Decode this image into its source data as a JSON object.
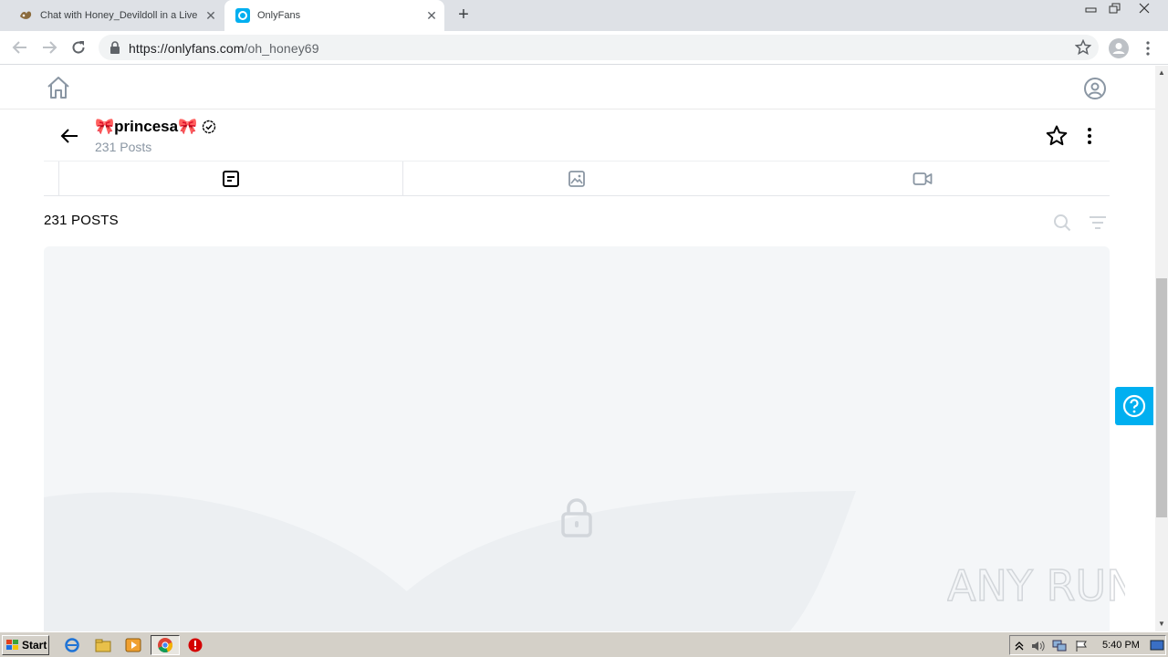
{
  "browser": {
    "tabs": [
      {
        "title": "Chat with Honey_Devildoll in a Live A",
        "active": false
      },
      {
        "title": "OnlyFans",
        "active": true
      }
    ],
    "url_host": "https://onlyfans.com",
    "url_path": "/oh_honey69"
  },
  "profile": {
    "name": "🎀princesa🎀",
    "posts_subtitle": "231 Posts"
  },
  "content": {
    "posts_heading": "231 POSTS"
  },
  "watermark": "ANY RUN",
  "taskbar": {
    "start_label": "Start",
    "clock": "5:40 PM"
  },
  "colors": {
    "brand": "#00aff0",
    "muted": "#8a96a3"
  },
  "icons": [
    "home-icon",
    "user-icon",
    "back-icon",
    "verified-icon",
    "star-icon",
    "more-icon",
    "posts-tab-icon",
    "photos-tab-icon",
    "videos-tab-icon",
    "search-icon",
    "sort-icon",
    "lock-icon",
    "help-icon"
  ]
}
